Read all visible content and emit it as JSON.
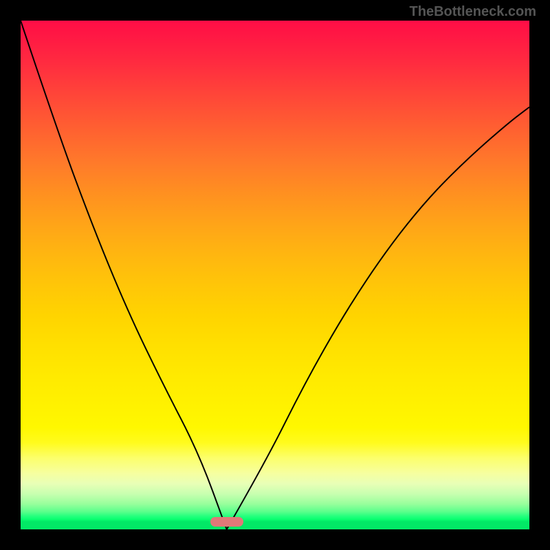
{
  "watermark": "TheBottleneck.com",
  "chart_data": {
    "type": "line",
    "title": "",
    "xlabel": "",
    "ylabel": "",
    "series": [
      {
        "name": "curve",
        "x": [
          0,
          7,
          14,
          21,
          28,
          35,
          40.5,
          48,
          56,
          64,
          72,
          80,
          88,
          96,
          100
        ],
        "values": [
          100,
          79,
          60,
          43,
          28.5,
          15,
          0,
          13,
          29,
          43,
          55,
          65,
          73,
          80,
          83
        ]
      }
    ],
    "marker": {
      "x": 40.5,
      "y": 1.5,
      "width_pct": 6.5
    },
    "xlim": [
      0,
      100
    ],
    "ylim": [
      0,
      100
    ]
  }
}
